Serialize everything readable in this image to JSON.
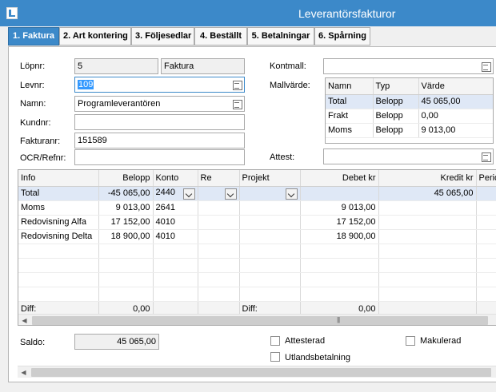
{
  "window": {
    "title": "Leverantörsfakturor"
  },
  "tabs": [
    {
      "label": "1. Faktura",
      "active": true
    },
    {
      "label": "2. Art kontering",
      "active": false
    },
    {
      "label": "3. Följesedlar",
      "active": false
    },
    {
      "label": "4. Beställt",
      "active": false
    },
    {
      "label": "5. Betalningar",
      "active": false
    },
    {
      "label": "6. Spårning",
      "active": false
    }
  ],
  "form": {
    "lopnr_label": "Löpnr:",
    "lopnr_value": "5",
    "lopnr_type": "Faktura",
    "levnr_label": "Levnr:",
    "levnr_value": "109",
    "namn_label": "Namn:",
    "namn_value": "Programleverantören",
    "kundnr_label": "Kundnr:",
    "kundnr_value": "",
    "fakturanr_label": "Fakturanr:",
    "fakturanr_value": "151589",
    "ocr_label": "OCR/Refnr:",
    "ocr_value": "",
    "kontmall_label": "Kontmall:",
    "kontmall_value": "",
    "mallvarde_label": "Mallvärde:",
    "attest_label": "Attest:",
    "attest_value": ""
  },
  "mallvarde": {
    "headers": [
      "Namn",
      "Typ",
      "Värde"
    ],
    "rows": [
      [
        "Total",
        "Belopp",
        "45 065,00"
      ],
      [
        "Frakt",
        "Belopp",
        "0,00"
      ],
      [
        "Moms",
        "Belopp",
        "9 013,00"
      ]
    ]
  },
  "kontering": {
    "headers": [
      "Info",
      "Belopp",
      "Konto",
      "Re",
      "Projekt",
      "Debet kr",
      "Kredit kr",
      "Perio"
    ],
    "rows": [
      [
        "Total",
        "-45 065,00",
        "2440",
        "",
        "",
        "",
        "45 065,00",
        ""
      ],
      [
        "Moms",
        "9 013,00",
        "2641",
        "",
        "",
        "9 013,00",
        "",
        ""
      ],
      [
        "Redovisning Alfa",
        "17 152,00",
        "4010",
        "",
        "",
        "17 152,00",
        "",
        ""
      ],
      [
        "Redovisning Delta",
        "18 900,00",
        "4010",
        "",
        "",
        "18 900,00",
        "",
        ""
      ]
    ],
    "diff_label_1": "Diff:",
    "diff_value_1": "0,00",
    "diff_label_2": "Diff:",
    "diff_value_2": "0,00"
  },
  "footer": {
    "saldo_label": "Saldo:",
    "saldo_value": "45 065,00",
    "attesterad_label": "Attesterad",
    "utlands_label": "Utlandsbetalning",
    "makulerad_label": "Makulerad"
  },
  "colors": {
    "accent": "#3c89c9",
    "selected_row": "#dfe8f6"
  }
}
